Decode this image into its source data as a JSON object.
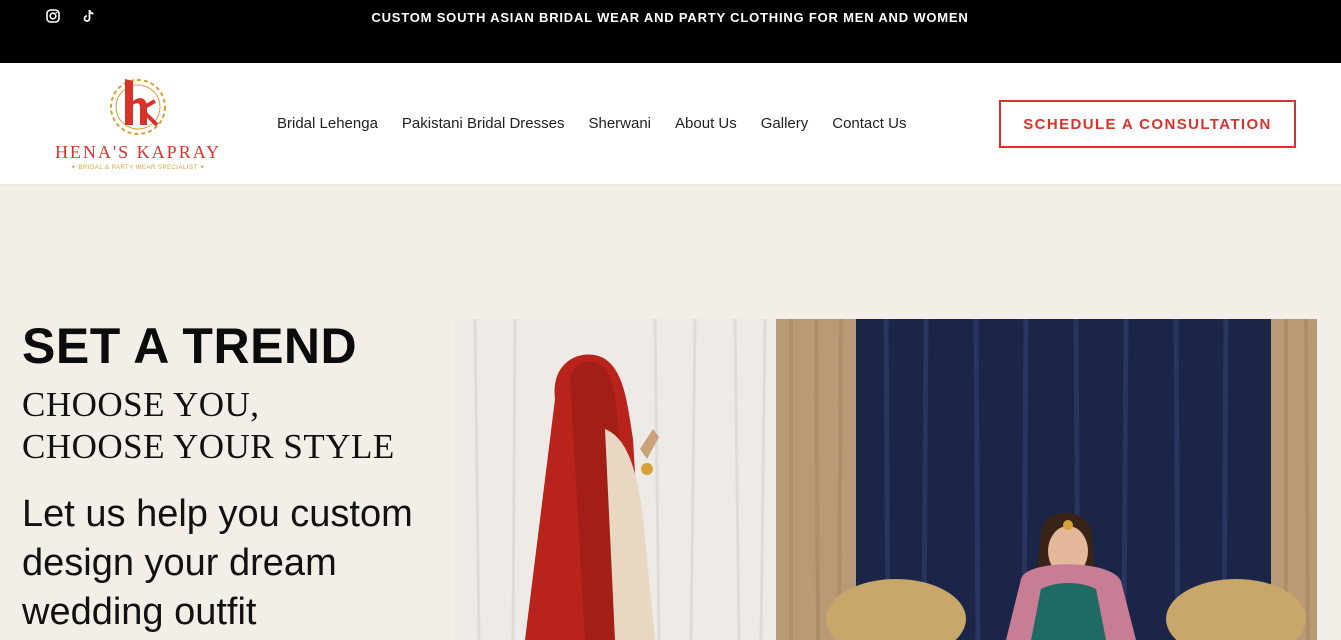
{
  "topbar": {
    "announcement": "CUSTOM SOUTH ASIAN BRIDAL WEAR AND PARTY CLOTHING FOR MEN AND WOMEN",
    "social_icons": [
      "instagram-icon",
      "tiktok-icon"
    ]
  },
  "header": {
    "logo": {
      "brand": "HENA'S KAPRAY",
      "tagline": "✦ BRIDAL & PARTY WEAR SPECIALIST ✦"
    },
    "nav": [
      {
        "label": "Bridal Lehenga"
      },
      {
        "label": "Pakistani Bridal Dresses"
      },
      {
        "label": "Sherwani"
      },
      {
        "label": "About Us"
      },
      {
        "label": "Gallery"
      },
      {
        "label": "Contact Us"
      }
    ],
    "cta_label": "SCHEDULE A CONSULTATION"
  },
  "hero": {
    "title": "SET A TREND",
    "subtitle_line1": "CHOOSE YOU,",
    "subtitle_line2": "CHOOSE YOUR STYLE",
    "body": "Let us help you custom design your dream wedding outfit"
  },
  "colors": {
    "accent": "#d8332a",
    "gold": "#d8a23a",
    "background": "#f3efe8",
    "topbar": "#000000"
  }
}
